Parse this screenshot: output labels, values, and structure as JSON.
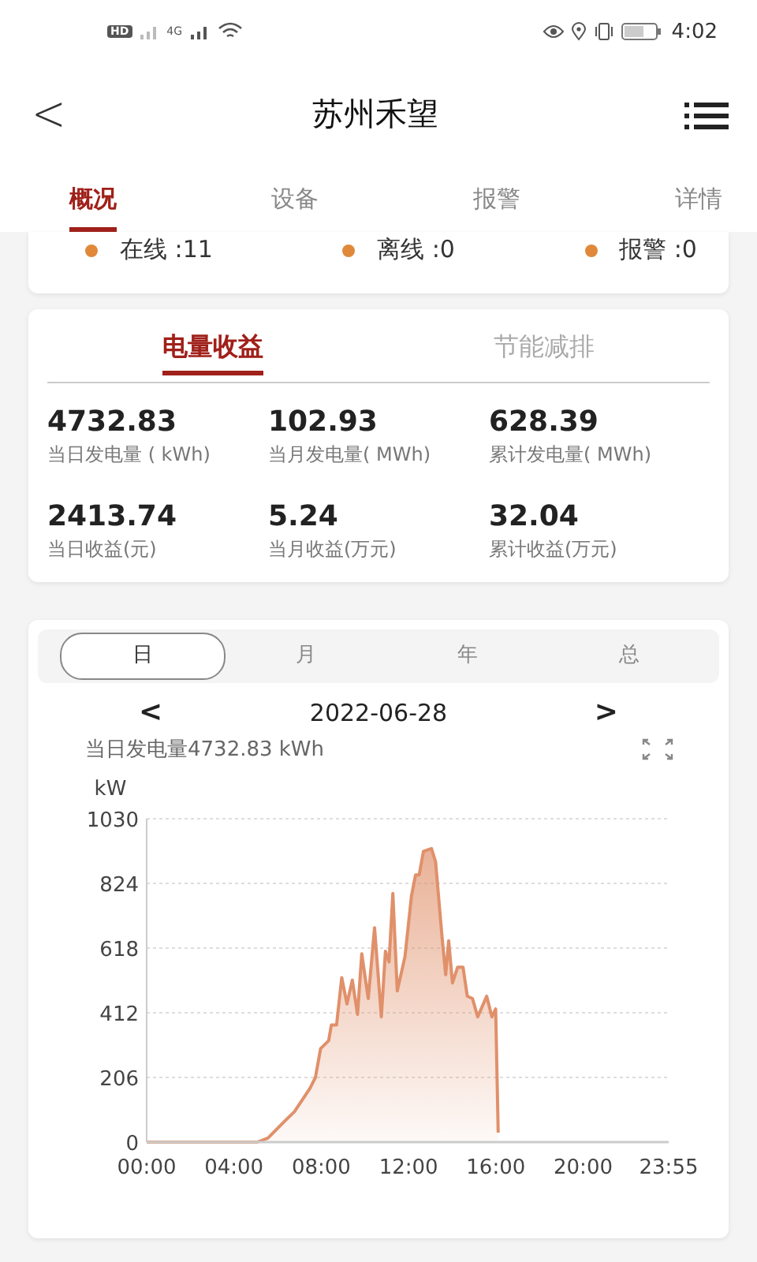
{
  "status_bar": {
    "badges": [
      "HD",
      "4G"
    ],
    "time": "4:02"
  },
  "header": {
    "back": "<",
    "title": "苏州禾望"
  },
  "tabs": [
    {
      "label": "概况",
      "selected": true
    },
    {
      "label": "设备",
      "selected": false
    },
    {
      "label": "报警",
      "selected": false
    },
    {
      "label": "详情",
      "selected": false
    }
  ],
  "status_counts": [
    "在线 :11",
    "离线 :0",
    "报警 :0"
  ],
  "stats_tabs": [
    {
      "label": "电量收益",
      "selected": true
    },
    {
      "label": "节能减排",
      "selected": false
    }
  ],
  "stats": [
    {
      "value": "4732.83",
      "label": "当日发电量 ( kWh)"
    },
    {
      "value": "102.93",
      "label": "当月发电量( MWh)"
    },
    {
      "value": "628.39",
      "label": "累计发电量( MWh)"
    },
    {
      "value": "2413.74",
      "label": "当日收益(元)"
    },
    {
      "value": "5.24",
      "label": "当月收益(万元)"
    },
    {
      "value": "32.04",
      "label": "累计收益(万元)"
    }
  ],
  "periods": [
    {
      "label": "日",
      "selected": true
    },
    {
      "label": "月",
      "selected": false
    },
    {
      "label": "年",
      "selected": false
    },
    {
      "label": "总",
      "selected": false
    }
  ],
  "date_nav": {
    "prev": "<",
    "date": "2022-06-28",
    "next": ">"
  },
  "summary": "当日发电量4732.83 kWh",
  "chart_data": {
    "type": "area",
    "ylabel": "kW",
    "ylim": [
      0,
      1030
    ],
    "xlim": [
      0,
      23.92
    ],
    "yticks": [
      0,
      206,
      412,
      618,
      824,
      1030
    ],
    "xticks": [
      {
        "value": 0,
        "label": "00:00"
      },
      {
        "value": 4,
        "label": "04:00"
      },
      {
        "value": 8,
        "label": "08:00"
      },
      {
        "value": 12,
        "label": "12:00"
      },
      {
        "value": 16,
        "label": "16:00"
      },
      {
        "value": 20,
        "label": "20:00"
      },
      {
        "value": 23.92,
        "label": "23:55"
      }
    ],
    "x": [
      0,
      5.07,
      5.56,
      6.28,
      6.77,
      7.49,
      7.73,
      7.97,
      8.34,
      8.46,
      8.7,
      8.94,
      9.18,
      9.42,
      9.66,
      9.86,
      10.15,
      10.44,
      10.75,
      10.94,
      11.11,
      11.28,
      11.48,
      11.84,
      12.13,
      12.32,
      12.49,
      12.68,
      13.05,
      13.24,
      13.53,
      13.7,
      13.84,
      14.01,
      14.25,
      14.5,
      14.69,
      14.93,
      15.17,
      15.58,
      15.82,
      15.99,
      16.11
    ],
    "grid": true,
    "series": [
      {
        "color": "#e0906a",
        "values": [
          0,
          0,
          13,
          64,
          97,
          172,
          206,
          298,
          323,
          373,
          373,
          524,
          440,
          516,
          407,
          600,
          457,
          683,
          399,
          608,
          574,
          792,
          482,
          591,
          784,
          851,
          851,
          926,
          935,
          893,
          658,
          533,
          641,
          507,
          557,
          557,
          465,
          457,
          399,
          465,
          399,
          424,
          30
        ]
      }
    ]
  }
}
